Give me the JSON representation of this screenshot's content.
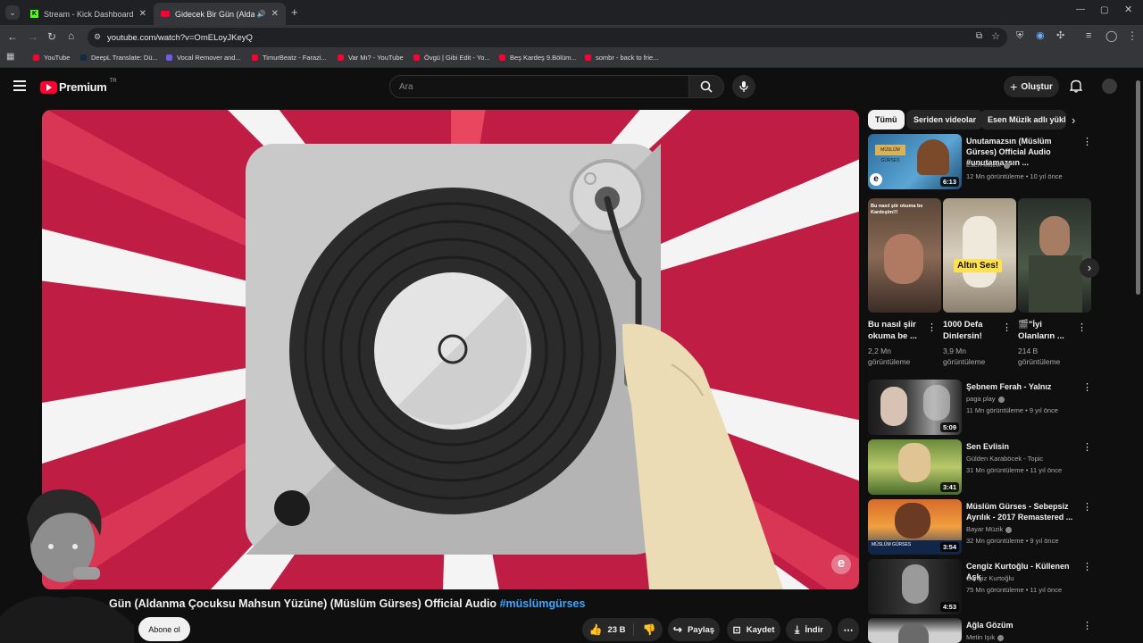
{
  "browser": {
    "tabs": [
      {
        "title": "Stream - Kick Dashboard",
        "active": false
      },
      {
        "title": "Gidecek Bir Gün (Aldanma Ç",
        "active": true
      }
    ],
    "url": "youtube.com/watch?v=OmELoyJKeyQ",
    "bookmarks": [
      "YouTube",
      "DeepL Translate: Dü...",
      "Vocal Remover and...",
      "TimurBeatz - Farazi...",
      "Var Mı? - YouTube",
      "Övgü | Gibi Edit - Yo...",
      "Beş Kardeş 9.Bölüm...",
      "sombr - back to frie..."
    ]
  },
  "youtube": {
    "logo_text": "Premium",
    "logo_sup": "TR",
    "search_placeholder": "Ara",
    "create_label": "Oluştur"
  },
  "video": {
    "title_visible": "Gün (Aldanma Çocuksu Mahsun Yüzüne) (Müslüm Gürses) Official Audio",
    "hashtag": "#müslümgürses",
    "subscribe_label": "Abone ol",
    "like_count": "23 B",
    "share_label": "Paylaş",
    "save_label": "Kaydet",
    "download_label": "İndir",
    "watermark": "e"
  },
  "colors": {
    "accent_red": "#ff0033",
    "video_bg": "#c01d44",
    "link_blue": "#3ea6ff"
  },
  "sidebar": {
    "chips": [
      "Tümü",
      "Seriden videolar",
      "Esen Müzik adlı yükle"
    ],
    "recs_top": [
      {
        "title": "Unutamazsın (Müslüm Gürses) Official Audio #unutamazsın ...",
        "channel": "Esen Müzik",
        "meta": "12 Mn görüntüleme • 10 yıl önce",
        "duration": "6:13"
      }
    ],
    "shorts": [
      {
        "title": "Bu nasıl şiir okuma be ...",
        "views": "2,2 Mn görüntüleme",
        "overlay": "Bu nasıl şiir okuma be Kardeşim!!!"
      },
      {
        "title": "1000 Defa Dinlersin!",
        "views": "3,9 Mn görüntüleme",
        "overlay": "Altın Ses!"
      },
      {
        "title": "🎬\"İyi Olanların ...",
        "views": "214 B görüntüleme",
        "overlay": ""
      }
    ],
    "recs": [
      {
        "title": "Şebnem Ferah - Yalnız",
        "channel": "paga play",
        "meta": "11 Mn görüntüleme • 9 yıl önce",
        "duration": "5:09"
      },
      {
        "title": "Sen Evlisin",
        "channel": "Gülden Karaböcek - Topic",
        "meta": "31 Mn görüntüleme • 11 yıl önce",
        "duration": "3:41"
      },
      {
        "title": "Müslüm Gürses - Sebepsiz Ayrılık - 2017 Remastered ...",
        "channel": "Bayar Müzik",
        "meta": "32 Mn görüntüleme • 9 yıl önce",
        "duration": "3:54"
      },
      {
        "title": "Cengiz Kurtoğlu - Küllenen Aşk",
        "channel": "Cengiz Kurtoğlu",
        "meta": "75 Mn görüntüleme • 11 yıl önce",
        "duration": "4:53"
      },
      {
        "title": "Ağla Gözüm",
        "channel": "Metin Işık",
        "meta": "",
        "duration": ""
      }
    ]
  }
}
